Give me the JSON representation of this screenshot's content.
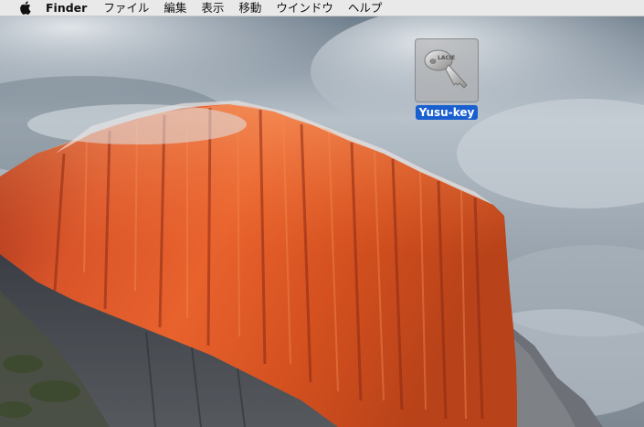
{
  "menubar": {
    "apple_icon": "apple-icon",
    "app_name": "Finder",
    "items": [
      "ファイル",
      "編集",
      "表示",
      "移動",
      "ウインドウ",
      "ヘルプ"
    ]
  },
  "desktop": {
    "icons": [
      {
        "label": "Yusu-key",
        "icon": "key-drive-icon",
        "selected": true
      }
    ],
    "selection_color": "#1a5fd0"
  }
}
